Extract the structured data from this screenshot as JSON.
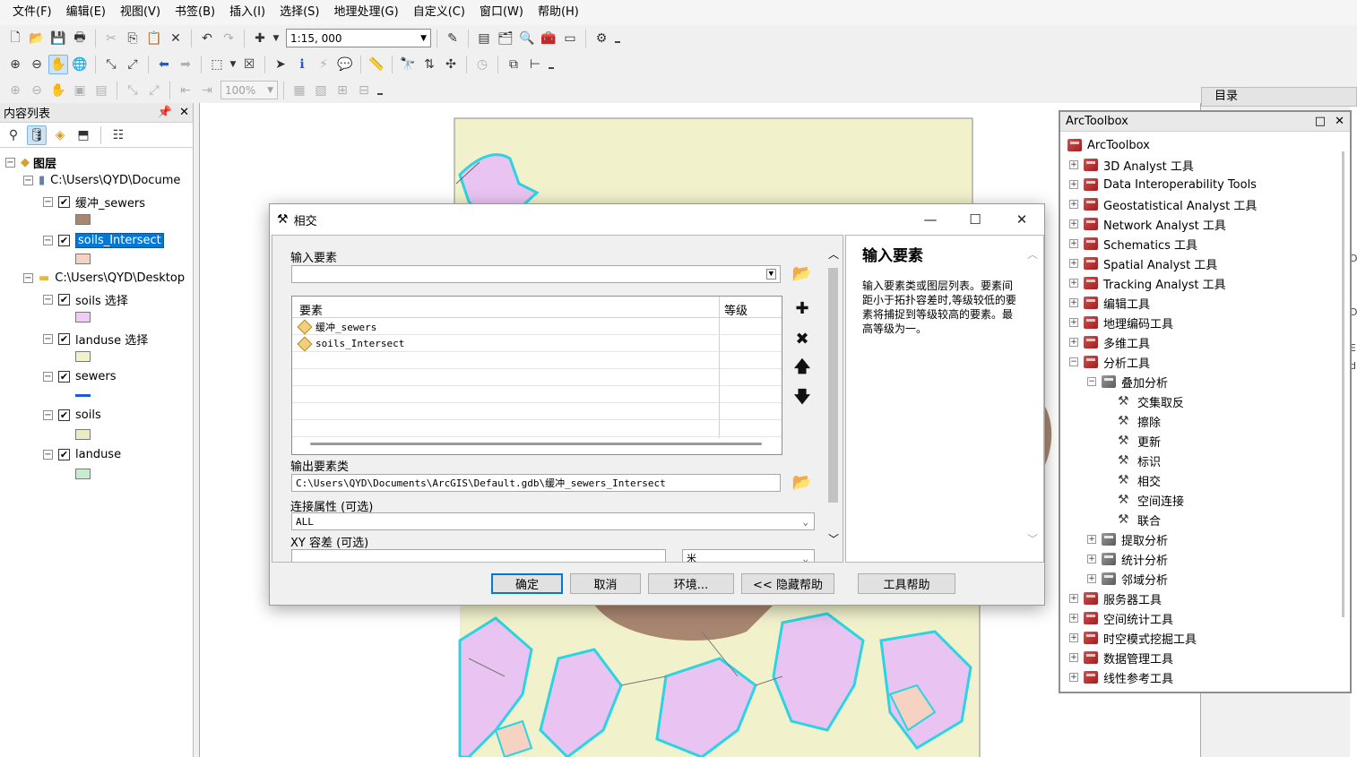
{
  "menu": [
    "文件(F)",
    "编辑(E)",
    "视图(V)",
    "书签(B)",
    "插入(I)",
    "选择(S)",
    "地理处理(G)",
    "自定义(C)",
    "窗口(W)",
    "帮助(H)"
  ],
  "toolbar": {
    "scale": "1:15, 000",
    "zoom": "100%"
  },
  "toc": {
    "title": "内容列表",
    "pin": "ᵖ",
    "root": "图层",
    "groups": [
      {
        "path": "C:\\Users\\QYD\\Docume",
        "layers": [
          {
            "name": "缓冲_sewers",
            "color": "#a98670"
          },
          {
            "name": "soils_Intersect",
            "color": "#f5d2c1",
            "selected": true
          }
        ]
      },
      {
        "path": "C:\\Users\\QYD\\Desktop",
        "layers": [
          {
            "name": "soils 选择",
            "color": "#efccf5"
          },
          {
            "name": "landuse 选择",
            "color": "#f1f1cc"
          },
          {
            "name": "sewers",
            "color": "#1e5ad6",
            "line": true
          },
          {
            "name": "soils",
            "color": "#ececc4"
          },
          {
            "name": "landuse",
            "color": "#c8ecd0"
          }
        ]
      }
    ]
  },
  "catalog": {
    "tab": "目录"
  },
  "toolbox": {
    "title": "ArcToolbox",
    "root": "ArcToolbox",
    "items": [
      {
        "label": "3D Analyst 工具",
        "level": 1,
        "kind": "box",
        "exp": "+"
      },
      {
        "label": "Data Interoperability Tools",
        "level": 1,
        "kind": "box",
        "exp": "+"
      },
      {
        "label": "Geostatistical Analyst 工具",
        "level": 1,
        "kind": "box",
        "exp": "+"
      },
      {
        "label": "Network Analyst 工具",
        "level": 1,
        "kind": "box",
        "exp": "+"
      },
      {
        "label": "Schematics 工具",
        "level": 1,
        "kind": "box",
        "exp": "+"
      },
      {
        "label": "Spatial Analyst 工具",
        "level": 1,
        "kind": "box",
        "exp": "+"
      },
      {
        "label": "Tracking Analyst 工具",
        "level": 1,
        "kind": "box",
        "exp": "+"
      },
      {
        "label": "编辑工具",
        "level": 1,
        "kind": "box",
        "exp": "+"
      },
      {
        "label": "地理编码工具",
        "level": 1,
        "kind": "box",
        "exp": "+"
      },
      {
        "label": "多维工具",
        "level": 1,
        "kind": "box",
        "exp": "+"
      },
      {
        "label": "分析工具",
        "level": 1,
        "kind": "box",
        "exp": "−"
      },
      {
        "label": "叠加分析",
        "level": 2,
        "kind": "set",
        "exp": "−"
      },
      {
        "label": "交集取反",
        "level": 3,
        "kind": "tool"
      },
      {
        "label": "擦除",
        "level": 3,
        "kind": "tool"
      },
      {
        "label": "更新",
        "level": 3,
        "kind": "tool"
      },
      {
        "label": "标识",
        "level": 3,
        "kind": "tool"
      },
      {
        "label": "相交",
        "level": 3,
        "kind": "tool"
      },
      {
        "label": "空间连接",
        "level": 3,
        "kind": "tool"
      },
      {
        "label": "联合",
        "level": 3,
        "kind": "tool"
      },
      {
        "label": "提取分析",
        "level": 2,
        "kind": "set",
        "exp": "+"
      },
      {
        "label": "统计分析",
        "level": 2,
        "kind": "set",
        "exp": "+"
      },
      {
        "label": "邻域分析",
        "level": 2,
        "kind": "set",
        "exp": "+"
      },
      {
        "label": "服务器工具",
        "level": 1,
        "kind": "box",
        "exp": "+"
      },
      {
        "label": "空间统计工具",
        "level": 1,
        "kind": "box",
        "exp": "+"
      },
      {
        "label": "时空模式挖掘工具",
        "level": 1,
        "kind": "box",
        "exp": "+"
      },
      {
        "label": "数据管理工具",
        "level": 1,
        "kind": "box",
        "exp": "+"
      },
      {
        "label": "线性参考工具",
        "level": 1,
        "kind": "box",
        "exp": "+"
      }
    ]
  },
  "dialog": {
    "title": "相交",
    "input_label": "输入要素",
    "input_value": "",
    "table": {
      "col_feature": "要素",
      "col_rank": "等级",
      "rows": [
        "缓冲_sewers",
        "soils_Intersect"
      ]
    },
    "output_label": "输出要素类",
    "output_value": "C:\\Users\\QYD\\Documents\\ArcGIS\\Default.gdb\\缓冲_sewers_Intersect",
    "join_label": "连接属性 (可选)",
    "join_value": "ALL",
    "xy_label": "XY 容差 (可选)",
    "xy_unit": "米",
    "help_title": "输入要素",
    "help_text": "输入要素类或图层列表。要素间距小于拓扑容差时,等级较低的要素将捕捉到等级较高的要素。最高等级为一。",
    "buttons": {
      "ok": "确定",
      "cancel": "取消",
      "env": "环境...",
      "hide_help": "<< 隐藏帮助",
      "tool_help": "工具帮助"
    }
  },
  "right_edge": [
    "D",
    "l",
    "l",
    "D",
    "l",
    "E",
    "d"
  ]
}
